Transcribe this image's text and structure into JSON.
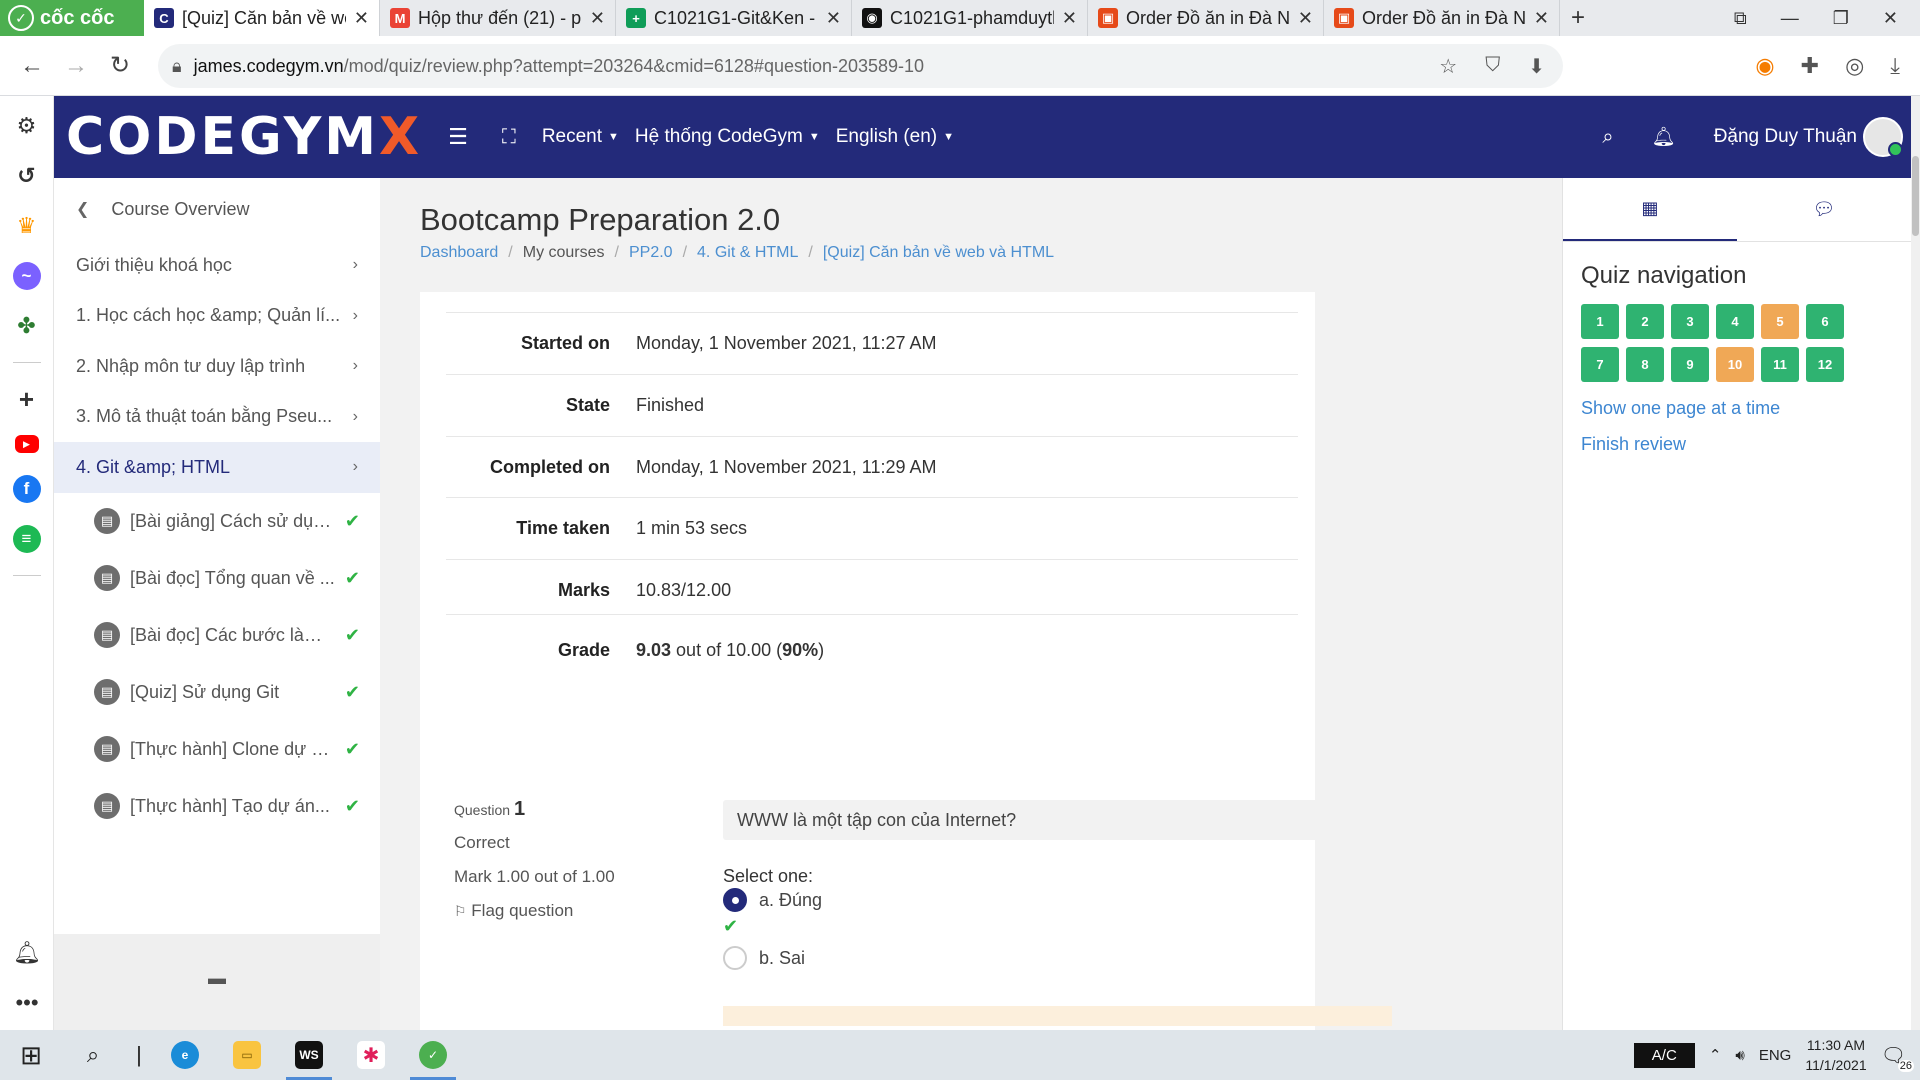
{
  "browser": {
    "brand": "cốc cốc",
    "tabs": [
      {
        "title": "[Quiz] Căn bản về web",
        "favicon": "codegym-icon",
        "color": "#232a7a",
        "letter": "C",
        "active": true
      },
      {
        "title": "Hộp thư đến (21) - p",
        "favicon": "gmail-icon",
        "color": "#ea4335",
        "letter": "M",
        "active": false
      },
      {
        "title": "C1021G1-Git&Ken -",
        "favicon": "sheets-icon",
        "color": "#0f9d58",
        "letter": "+",
        "active": false
      },
      {
        "title": "C1021G1-phamduytl",
        "favicon": "github-icon",
        "color": "#111111",
        "letter": "◉",
        "active": false
      },
      {
        "title": "Order Đồ ăn in Đà N",
        "favicon": "store-icon",
        "color": "#e64a19",
        "letter": "▣",
        "active": false
      },
      {
        "title": "Order Đồ ăn in Đà N",
        "favicon": "store-icon",
        "color": "#e64a19",
        "letter": "▣",
        "active": false
      }
    ],
    "url_host": "james.codegym.vn",
    "url_path": "/mod/quiz/review.php?attempt=203264&cmid=6128#question-203589-10"
  },
  "navbar": {
    "logo_main": "CODEGYM",
    "logo_x": "X",
    "recent": "Recent",
    "system": "Hệ thống CodeGym",
    "language": "English (en)",
    "user": "Đặng Duy Thuận"
  },
  "drawer": {
    "back": "Course Overview",
    "items": [
      "Giới thiệu khoá học",
      "1. Học cách học &amp; Quản lí...",
      "2. Nhập môn tư duy lập trình",
      "3. Mô tả thuật toán bằng Pseu...",
      "4. Git &amp; HTML"
    ],
    "subitems": [
      "[Bài giảng] Cách sử dụn...",
      "[Bài đọc] Tổng quan về ...",
      "[Bài đọc] Các bước làm ...",
      "[Quiz] Sử dụng Git",
      "[Thực hành] Clone dự á...",
      "[Thực hành] Tạo dự án..."
    ]
  },
  "page": {
    "course_title": "Bootcamp Preparation 2.0",
    "breadcrumb": {
      "dashboard": "Dashboard",
      "mycourses": "My courses",
      "course": "PP2.0",
      "section": "4. Git & HTML",
      "quiz": "[Quiz] Căn bản về web và HTML"
    }
  },
  "summary": [
    {
      "key": "Started on",
      "value": "Monday, 1 November 2021, 11:27 AM"
    },
    {
      "key": "State",
      "value": "Finished"
    },
    {
      "key": "Completed on",
      "value": "Monday, 1 November 2021, 11:29 AM"
    },
    {
      "key": "Time taken",
      "value": "1 min 53 secs"
    },
    {
      "key": "Marks",
      "value": "10.83/12.00"
    }
  ],
  "grade": {
    "key": "Grade",
    "score": "9.03",
    "mid": " out of 10.00 (",
    "percent": "90%",
    "end": ")"
  },
  "question": {
    "label": "Question",
    "number": "1",
    "status": "Correct",
    "mark": "Mark 1.00 out of 1.00",
    "flag": "Flag question",
    "text": "WWW là một tập con của Internet?",
    "select": "Select one:",
    "option_a": "a. Đúng",
    "option_b": "b. Sai"
  },
  "quiz_nav": {
    "title": "Quiz navigation",
    "buttons": [
      {
        "n": "1",
        "state": "g"
      },
      {
        "n": "2",
        "state": "g"
      },
      {
        "n": "3",
        "state": "g"
      },
      {
        "n": "4",
        "state": "g"
      },
      {
        "n": "5",
        "state": "o"
      },
      {
        "n": "6",
        "state": "g"
      },
      {
        "n": "7",
        "state": "g"
      },
      {
        "n": "8",
        "state": "g"
      },
      {
        "n": "9",
        "state": "g"
      },
      {
        "n": "10",
        "state": "o"
      },
      {
        "n": "11",
        "state": "g"
      },
      {
        "n": "12",
        "state": "g"
      }
    ],
    "show_one": "Show one page at a time",
    "finish": "Finish review"
  },
  "taskbar": {
    "ac": "A/C",
    "lang": "ENG",
    "time": "11:30 AM",
    "date": "11/1/2021",
    "notif": "26"
  }
}
